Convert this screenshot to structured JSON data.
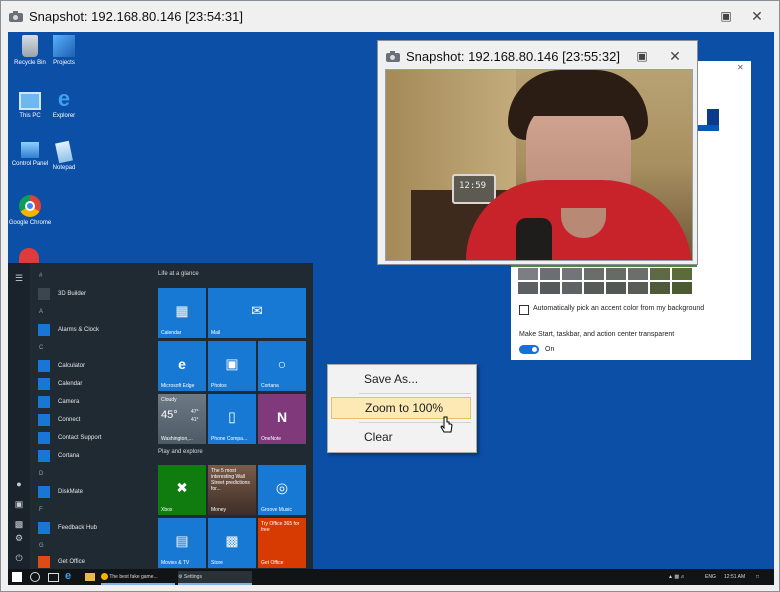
{
  "main_window": {
    "title": "Snapshot: 192.168.80.146 [23:54:31]",
    "icon": "camera-icon",
    "buttons": [
      "restore-icon",
      "close-icon"
    ]
  },
  "desktop": {
    "icons": [
      {
        "label": "Recycle Bin",
        "icon": "recycle-bin-icon"
      },
      {
        "label": "Projects",
        "icon": "projects-icon"
      },
      {
        "label": "This PC",
        "icon": "this-pc-icon"
      },
      {
        "label": "Explorer",
        "icon": "internet-explorer-icon"
      },
      {
        "label": "Control Panel",
        "icon": "control-panel-icon"
      },
      {
        "label": "Notepad",
        "icon": "notepad-icon"
      },
      {
        "label": "Google Chrome",
        "icon": "chrome-icon"
      }
    ]
  },
  "snapshot_window": {
    "title": "Snapshot: 192.168.80.146 [23:55:32]",
    "clock_reading": "12:59"
  },
  "context_menu": {
    "items": [
      {
        "label": "Save As..."
      },
      {
        "label": "Zoom to 100%"
      },
      {
        "label": "Clear"
      }
    ]
  },
  "settings_panel": {
    "checkbox_label": "Automatically pick an accent color from my background",
    "transparency_label": "Make Start, taskbar, and action center transparent",
    "toggle_state": "On",
    "accent_swatches": [
      "#6b6e72",
      "#717478",
      "#6a6d6a",
      "#676b66",
      "#6b6f69",
      "#5d6a45",
      "#5b6b3a"
    ]
  },
  "start_menu": {
    "group1": "Life at a glance",
    "group2": "Play and explore",
    "apps": [
      {
        "letter": "#",
        "label": "3D Builder"
      },
      {
        "letter": "A",
        "label": "Alarms & Clock"
      },
      {
        "letter": "C",
        "label": "Calculator"
      },
      {
        "label": "Calendar"
      },
      {
        "label": "Camera"
      },
      {
        "label": "Connect"
      },
      {
        "label": "Contact Support"
      },
      {
        "label": "Cortana"
      },
      {
        "letter": "D",
        "label": "DiskMate"
      },
      {
        "letter": "F",
        "label": "Feedback Hub"
      },
      {
        "letter": "G",
        "label": "Get Office"
      }
    ],
    "tiles": [
      {
        "label": "Calendar",
        "icon": "calendar-icon"
      },
      {
        "label": "Mail",
        "icon": "mail-icon"
      },
      {
        "label": "Microsoft Edge",
        "icon": "edge-icon"
      },
      {
        "label": "Photos",
        "icon": "photos-icon"
      },
      {
        "label": "Cortana",
        "icon": "cortana-icon"
      },
      {
        "label": "Washington,...",
        "icon": "weather-icon",
        "title": "Cloudy",
        "temp": "45°",
        "hi": "47°",
        "lo": "41°"
      },
      {
        "label": "Phone Compa...",
        "icon": "phone-icon"
      },
      {
        "label": "OneNote",
        "icon": "onenote-icon"
      },
      {
        "label": "Xbox",
        "icon": "xbox-icon"
      },
      {
        "label": "Money",
        "icon": "money-icon",
        "headline": "The 5 most interesting Wall Street predictions for..."
      },
      {
        "label": "Groove Music",
        "icon": "groove-icon"
      },
      {
        "label": "Movies & TV",
        "icon": "movies-icon"
      },
      {
        "label": "Store",
        "icon": "store-icon"
      },
      {
        "label": "Get Office",
        "icon": "office-icon",
        "headline": "Try Office 365 for free"
      }
    ]
  },
  "taskbar": {
    "items": [
      {
        "label": "The best fake game...",
        "icon": "chrome-icon"
      },
      {
        "label": "Settings",
        "icon": "gear-icon"
      }
    ],
    "lang": "ENG",
    "time": "12:51 AM"
  }
}
